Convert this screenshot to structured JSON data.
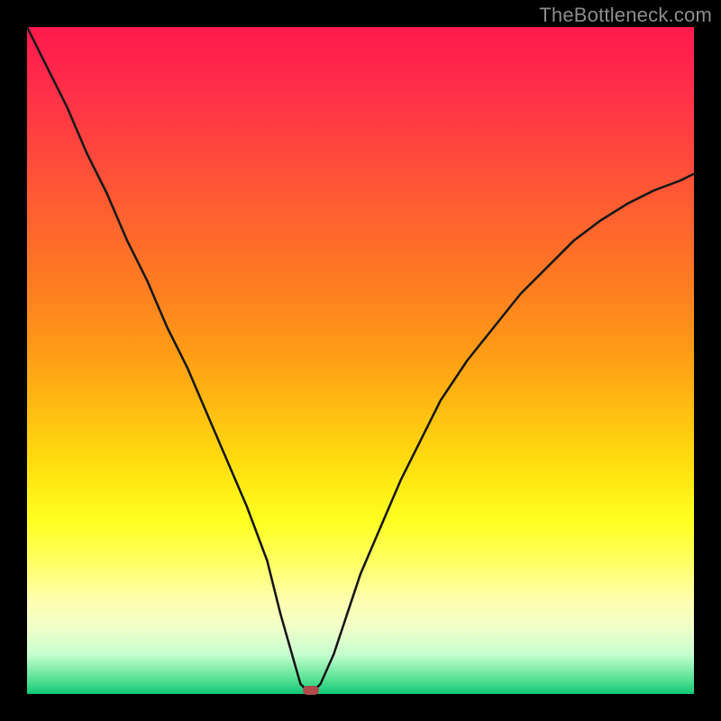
{
  "watermark": "TheBottleneck.com",
  "colors": {
    "frame_bg": "#000000",
    "curve_stroke": "#1a1a1a",
    "marker_fill": "#b04a4a",
    "gradient_top": "#ff1a4d",
    "gradient_bottom": "#10c878"
  },
  "chart_data": {
    "type": "line",
    "title": "",
    "xlabel": "",
    "ylabel": "",
    "xlim": [
      0,
      100
    ],
    "ylim": [
      0,
      100
    ],
    "notes": "V-shaped bottleneck curve on red→green vertical gradient. Axes unlabeled; values are percentage estimates from pixel positions (0 = left/bottom, 100 = right/top).",
    "series": [
      {
        "name": "bottleneck-curve",
        "x": [
          0,
          3,
          6,
          9,
          12,
          15,
          18,
          21,
          24,
          27,
          30,
          33,
          36,
          38,
          40,
          41,
          42,
          43,
          44,
          46,
          48,
          50,
          53,
          56,
          59,
          62,
          66,
          70,
          74,
          78,
          82,
          86,
          90,
          94,
          98,
          100
        ],
        "y": [
          100,
          94,
          88,
          81,
          75,
          68,
          62,
          55,
          49,
          42,
          35,
          28,
          20,
          12,
          5,
          1.5,
          0.5,
          0.5,
          1.5,
          6,
          12,
          18,
          25,
          32,
          38,
          44,
          50,
          55,
          60,
          64,
          68,
          71,
          73.5,
          75.5,
          77,
          78
        ]
      }
    ],
    "marker": {
      "x": 42.5,
      "y": 0.5
    }
  }
}
